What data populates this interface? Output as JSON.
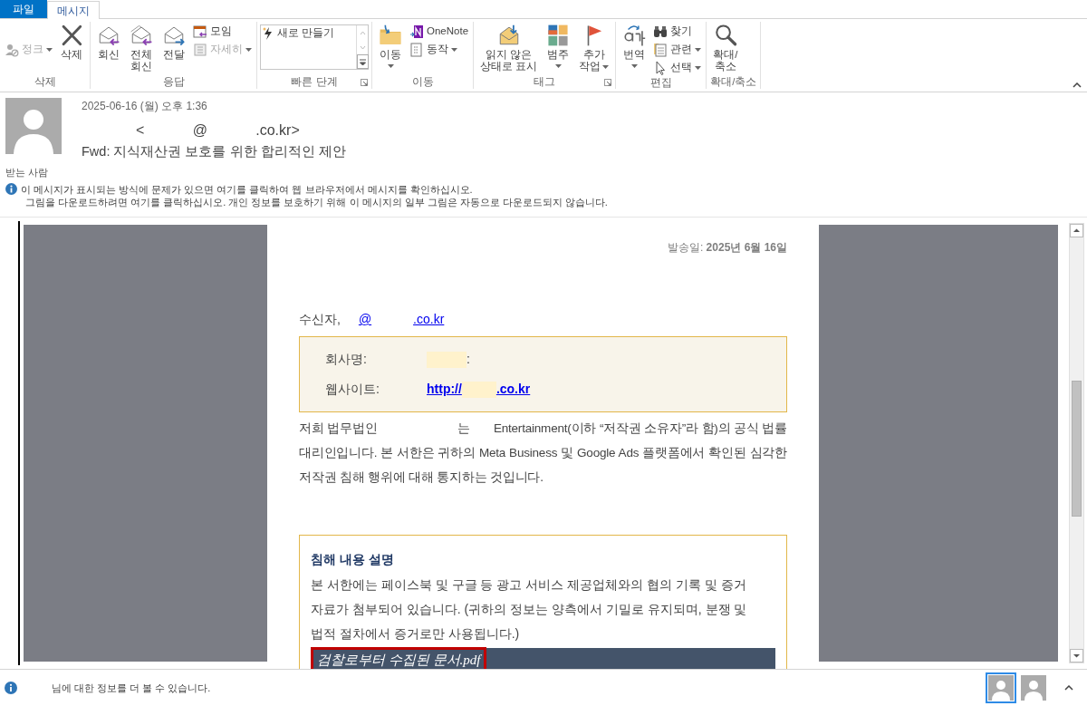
{
  "tabs": [
    {
      "label": "파일",
      "kind": "file",
      "selected": false
    },
    {
      "label": "메시지",
      "kind": "tab",
      "selected": true
    }
  ],
  "ribbon": {
    "groups": [
      {
        "label": "삭제",
        "launcher": false,
        "items": [
          {
            "kind": "stack",
            "items": [
              {
                "label": "정크",
                "disabled": true,
                "dropdown": true
              }
            ]
          },
          {
            "kind": "large",
            "lines": [
              "삭제"
            ],
            "disabled": false,
            "dropdown": false
          }
        ]
      },
      {
        "label": "응답",
        "launcher": false,
        "items": [
          {
            "kind": "large",
            "lines": [
              "회신"
            ],
            "disabled": false,
            "dropdown": false
          },
          {
            "kind": "large",
            "lines": [
              "전체",
              "회신"
            ],
            "disabled": false,
            "dropdown": false
          },
          {
            "kind": "large",
            "lines": [
              "전달"
            ],
            "disabled": false,
            "dropdown": false
          },
          {
            "kind": "stack",
            "items": [
              {
                "label": "모임",
                "disabled": false,
                "dropdown": false
              },
              {
                "label": "자세히",
                "disabled": true,
                "dropdown": true
              }
            ]
          }
        ]
      },
      {
        "label": "빠른 단계",
        "launcher": true,
        "items": [
          {
            "kind": "gallery",
            "entries": [
              {
                "label": "새로 만들기"
              }
            ]
          }
        ]
      },
      {
        "label": "이동",
        "launcher": false,
        "items": [
          {
            "kind": "large",
            "lines": [
              "이동"
            ],
            "disabled": false,
            "dropdown": true
          },
          {
            "kind": "stack",
            "items": [
              {
                "label": "OneNote",
                "disabled": false,
                "dropdown": false
              },
              {
                "label": "동작",
                "disabled": false,
                "dropdown": true
              }
            ]
          }
        ]
      },
      {
        "label": "태그",
        "launcher": true,
        "items": [
          {
            "kind": "large",
            "lines": [
              "읽지 않은",
              "상태로 표시"
            ],
            "disabled": false,
            "dropdown": false
          },
          {
            "kind": "large",
            "lines": [
              "범주"
            ],
            "disabled": false,
            "dropdown": true
          },
          {
            "kind": "large",
            "lines": [
              "추가",
              "작업"
            ],
            "disabled": false,
            "dropdown": true
          }
        ]
      },
      {
        "label": "편집",
        "launcher": false,
        "items": [
          {
            "kind": "large",
            "lines": [
              "번역"
            ],
            "disabled": false,
            "dropdown": true
          },
          {
            "kind": "stack",
            "items": [
              {
                "label": "찾기",
                "disabled": false,
                "dropdown": false
              },
              {
                "label": "관련",
                "disabled": false,
                "dropdown": true
              },
              {
                "label": "선택",
                "disabled": false,
                "dropdown": true
              }
            ]
          }
        ]
      },
      {
        "label": "확대/축소",
        "launcher": false,
        "items": [
          {
            "kind": "large",
            "lines": [
              "확대/",
              "축소"
            ],
            "disabled": false,
            "dropdown": false
          }
        ]
      }
    ]
  },
  "header": {
    "date": "2025-06-16 (월) 오후 1:36",
    "sender": "<            @            .co.kr>",
    "subject": "Fwd: 지식재산권 보호를 위한 합리적인 제안",
    "to_label": "받는 사람",
    "notices": [
      "이 메시지가 표시되는 방식에 문제가 있으면 여기를 클릭하여 웹 브라우저에서 메시지를 확인하십시오.",
      "그림을 다운로드하려면 여기를 클릭하십시오. 개인 정보를 보호하기 위해 이 메시지의 일부 그림은 자동으로 다운로드되지 않습니다."
    ]
  },
  "body": {
    "sent_date": "발송일: **2025년 6월 16일**",
    "recipient_label": "수신자,",
    "recipient_link": [
      "@",
      ".co.kr"
    ],
    "info_rows": [
      {
        "label": "회사명:",
        "kind": "text",
        "parts": [
          ":"
        ]
      },
      {
        "label": "웹사이트:",
        "kind": "link",
        "parts": [
          "http://",
          ".co.kr"
        ]
      }
    ],
    "paragraph": "저희 법무법인                        는       Entertainment(이하 “저작권 소유자”라 함)의 공식 법률 대리인입니다. 본 서한은 귀하의 Meta Business 및 Google Ads 플랫폼에서 확인된 심각한 저작권 침해 행위에 대해 통지하는 것입니다.",
    "section": {
      "title": "침해 내용 설명",
      "text": "본 서한에는 페이스북 및 구글 등 광고 서비스 제공업체와의 협의 기록 및 증거 자료가 첨부되어 있습니다. (귀하의 정보는 양측에서 기밀로 유지되며, 분쟁 및 법적 절차에서 증거로만 사용됩니다.)",
      "attachment": "검찰로부터 수집된 문서.pdf",
      "attachment_highlighted": true
    }
  },
  "status_bar": {
    "text": "님에 대한 정보를 더 볼 수 있습니다.",
    "people": [
      {
        "selected": true
      },
      {
        "selected": false
      }
    ]
  }
}
